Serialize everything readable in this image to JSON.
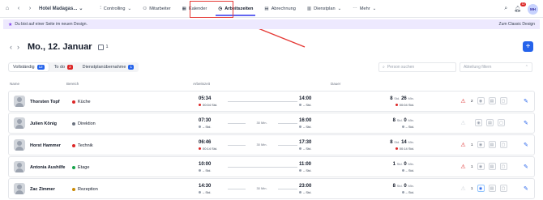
{
  "topbar": {
    "hotel": "Hotel Madagas...",
    "nav": [
      {
        "label": "Controlling",
        "icon": "chart-icon",
        "chev": true
      },
      {
        "label": "Mitarbeiter",
        "icon": "people-icon",
        "chev": false
      },
      {
        "label": "Kalender",
        "icon": "calendar-icon",
        "chev": false
      },
      {
        "label": "Arbeitszeiten",
        "icon": "clock-icon",
        "chev": false,
        "active": true
      },
      {
        "label": "Abrechnung",
        "icon": "billing-icon",
        "chev": false
      },
      {
        "label": "Dienstplan",
        "icon": "schedule-icon",
        "chev": true
      },
      {
        "label": "Mehr",
        "icon": "more-icon",
        "chev": true
      }
    ],
    "notification_count": "12",
    "avatar_initials": "MH"
  },
  "banner": {
    "text": "Du bist auf einer Seite im neuen Design.",
    "link": "Zum Classic Design"
  },
  "date": {
    "title": "Mo., 12. Januar",
    "count": "1"
  },
  "tabs": [
    {
      "label": "Vollständig",
      "count": "12",
      "color": "#2563eb",
      "active": true
    },
    {
      "label": "To do",
      "count": "2",
      "color": "#dc2626",
      "active": false
    },
    {
      "label": "Dienstplanübernahme",
      "count": "1",
      "color": "#2563eb",
      "active": false
    }
  ],
  "search": {
    "placeholder": "Person suchen"
  },
  "dept_filter": {
    "placeholder": "Abteilung filtern"
  },
  "columns": {
    "name": "Name",
    "area": "Bereich",
    "worktime": "Arbeitszeit",
    "duration": "Dauer"
  },
  "colors": {
    "accent": "#6366f1",
    "primary": "#2563eb",
    "danger": "#dc2626",
    "banner": "#ede9fe"
  },
  "rows": [
    {
      "name": "Thorsten Topf",
      "area": "Küche",
      "area_color": "#dc2626",
      "start": "05:34",
      "start_diff": "00:04 Std.",
      "start_diff_color": "#dc2626",
      "pause": "",
      "end": "14:00",
      "end_diff": "– Std.",
      "end_diff_color": "#9ca3af",
      "dur_h": "8",
      "dur_m": "26",
      "dur_diff": "00:04 Std.",
      "dur_diff_color": "#dc2626",
      "warn": true,
      "warn_count": "2"
    },
    {
      "name": "Julien König",
      "area": "Direktion",
      "area_color": "#6b7280",
      "start": "07:30",
      "start_diff": "– Std.",
      "start_diff_color": "#9ca3af",
      "pause": "30 Min.",
      "end": "16:00",
      "end_diff": "– Std.",
      "end_diff_color": "#9ca3af",
      "dur_h": "8",
      "dur_m": "0",
      "dur_diff": "– Std.",
      "dur_diff_color": "#9ca3af",
      "warn": false,
      "warn_count": ""
    },
    {
      "name": "Horst Hammer",
      "area": "Technik",
      "area_color": "#dc2626",
      "start": "06:46",
      "start_diff": "00:14 Std.",
      "start_diff_color": "#dc2626",
      "pause": "30 Min.",
      "end": "17:30",
      "end_diff": "– Std.",
      "end_diff_color": "#9ca3af",
      "dur_h": "8",
      "dur_m": "14",
      "dur_diff": "00:14 Std.",
      "dur_diff_color": "#dc2626",
      "warn": true,
      "warn_count": "1"
    },
    {
      "name": "Antonia Aushilfe",
      "area": "Etage",
      "area_color": "#16a34a",
      "start": "10:00",
      "start_diff": "– Std.",
      "start_diff_color": "#9ca3af",
      "pause": "",
      "end": "11:00",
      "end_diff": "– Std.",
      "end_diff_color": "#9ca3af",
      "dur_h": "1",
      "dur_m": "0",
      "dur_diff": "– Std.",
      "dur_diff_color": "#9ca3af",
      "warn": true,
      "warn_count": "1"
    },
    {
      "name": "Zac Zimmer",
      "area": "Rezeption",
      "area_color": "#ca8a04",
      "start": "14:30",
      "start_diff": "– Std.",
      "start_diff_color": "#9ca3af",
      "pause": "30 Min.",
      "end": "23:00",
      "end_diff": "– Std.",
      "end_diff_color": "#9ca3af",
      "dur_h": "8",
      "dur_m": "0",
      "dur_diff": "– Std.",
      "dur_diff_color": "#9ca3af",
      "warn": false,
      "warn_count": "1"
    }
  ]
}
